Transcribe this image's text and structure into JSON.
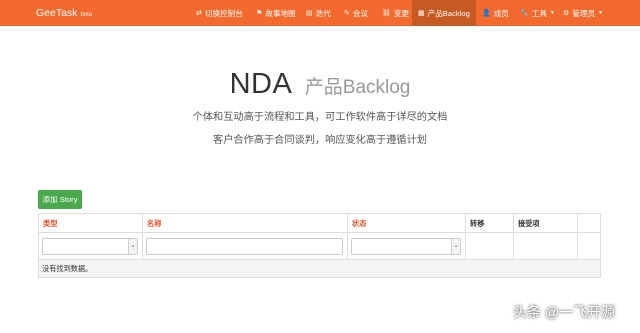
{
  "navbar": {
    "brand": "GeeTask",
    "brand_tag": "beta",
    "items": [
      {
        "icon": "⇄",
        "label": "切换控制台"
      },
      {
        "icon": "⚑",
        "label": "故事地图"
      },
      {
        "icon": "▤",
        "label": "迭代"
      },
      {
        "icon": "✎",
        "label": "会议"
      },
      {
        "icon": "⛓",
        "label": "变更"
      },
      {
        "icon": "▦",
        "label": "产品Backlog"
      },
      {
        "icon": "👤",
        "label": "成员"
      },
      {
        "icon": "🔧",
        "label": "工具"
      },
      {
        "icon": "⚙",
        "label": "管理员"
      }
    ],
    "active_color": "#c75a22",
    "bar_color": "#f26a2e"
  },
  "hero": {
    "title": "NDA",
    "subtitle": "产品Backlog",
    "line1": "个体和互动高于流程和工具，可工作软件高于详尽的文档",
    "line2": "客户合作高于合同谈判，响应变化高于遵循计划"
  },
  "add_button": "添加 Story",
  "table": {
    "headers": [
      "类型",
      "名称",
      "状态",
      "转移",
      "接受项"
    ],
    "empty_text": "没有找到数据。"
  },
  "watermark": "头条 @一飞开源"
}
